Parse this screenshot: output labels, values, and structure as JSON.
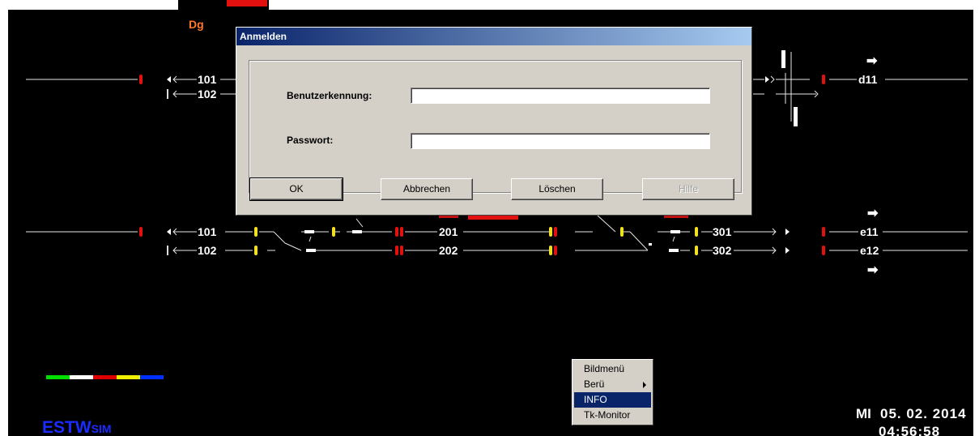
{
  "top_labels": {
    "dg": "Dg"
  },
  "tracks": {
    "upper": {
      "t101": "101",
      "t102": "102",
      "d11": "d11"
    },
    "lower": {
      "t101": "101",
      "t102": "102",
      "t201": "201",
      "t202": "202",
      "t301": "301",
      "t302": "302",
      "e11": "e11",
      "e12": "e12"
    }
  },
  "dialog": {
    "title": "Anmelden",
    "username_label": "Benutzerkennung:",
    "username_value": "",
    "password_label": "Passwort:",
    "password_value": "",
    "buttons": {
      "ok": "OK",
      "cancel": "Abbrechen",
      "clear": "Löschen",
      "help": "Hilfe"
    }
  },
  "context_menu": {
    "items": [
      "Bildmenü",
      "Berü",
      "INFO",
      "Tk-Monitor"
    ],
    "selected": "INFO"
  },
  "status": {
    "day": "MI",
    "date": "05. 02. 2014",
    "time": "04:56:58",
    "color_bar": [
      "#00e000",
      "#ffffff",
      "#e00000",
      "#f0f000",
      "#0030ff"
    ]
  },
  "logo": {
    "main": "ESTW",
    "sub": "SIM"
  },
  "colors": {
    "background": "#000000",
    "title_bar": "#0a246a",
    "menu_selection": "#0a246a"
  }
}
